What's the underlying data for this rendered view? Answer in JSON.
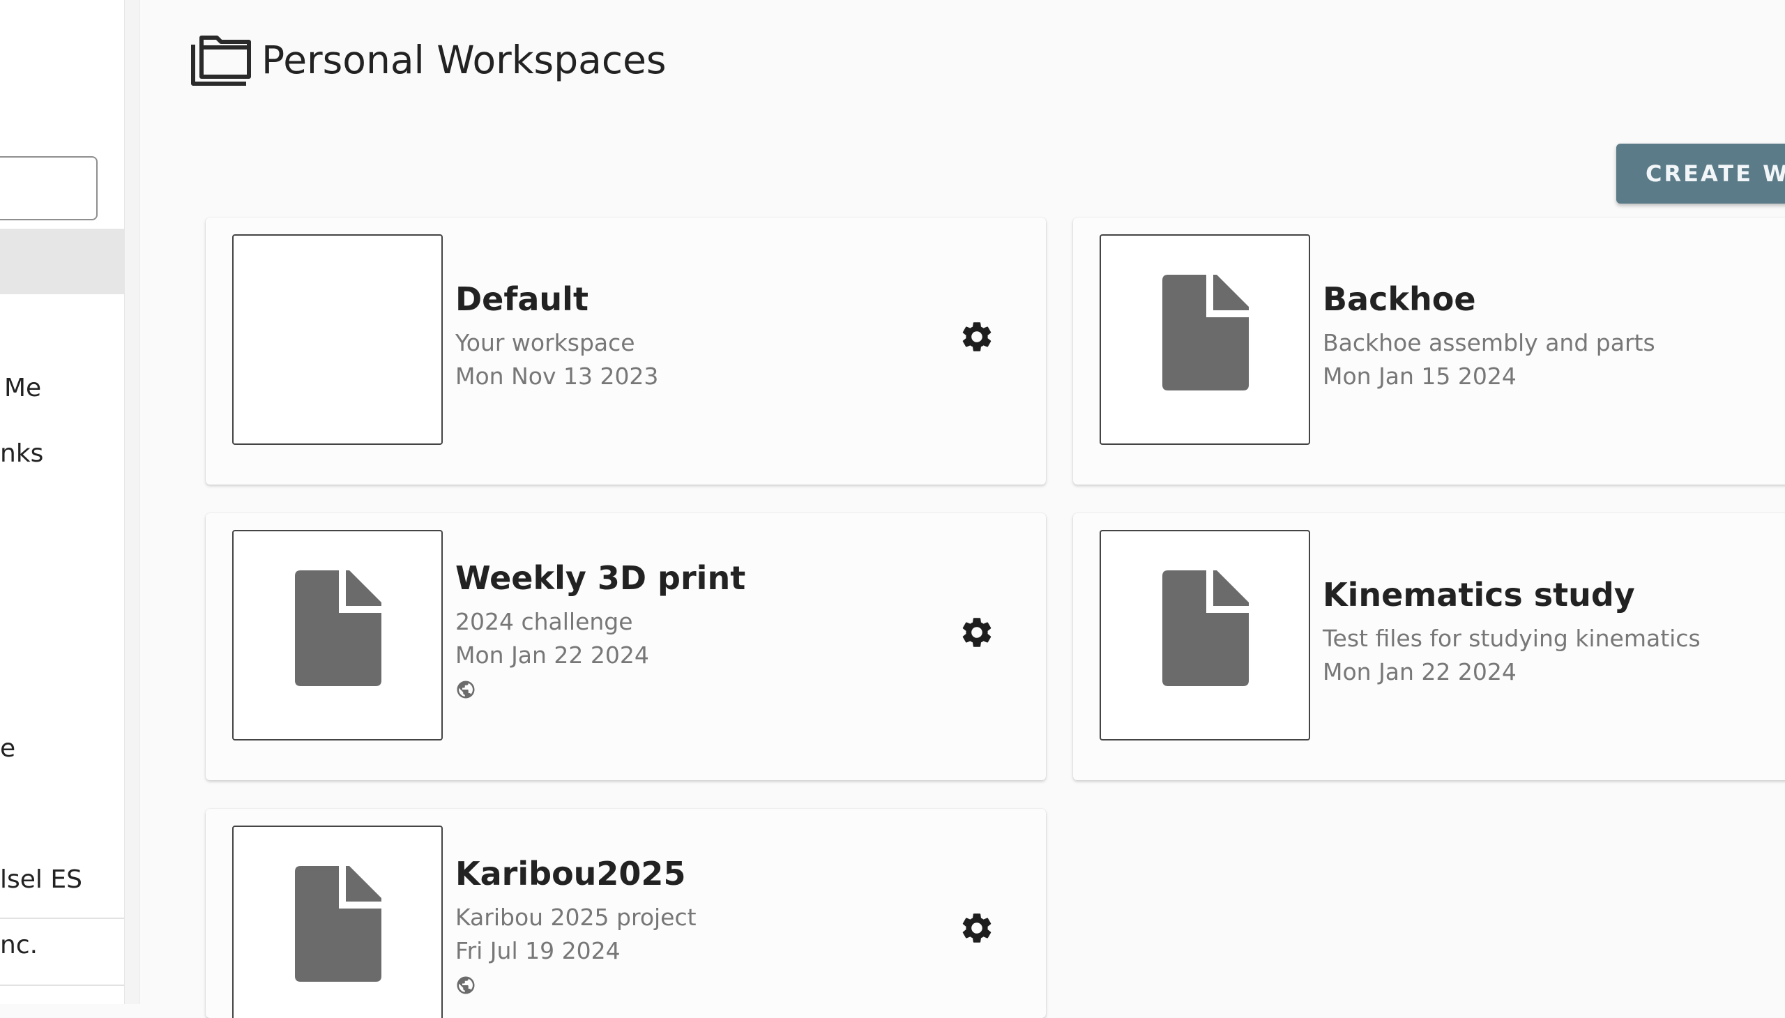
{
  "sidebar": {
    "items": [
      {
        "label": "Me"
      },
      {
        "label": "nks"
      },
      {
        "label": "e"
      },
      {
        "label": "lsel ES"
      },
      {
        "label": "nc."
      }
    ]
  },
  "header": {
    "title": "Personal Workspaces",
    "icon": "folder-icon"
  },
  "toolbar": {
    "create_label": "CREATE WO",
    "create_color": "#5b7b88"
  },
  "workspaces": [
    {
      "title": "Default",
      "description": "Your workspace",
      "date": "Mon Nov 13 2023",
      "thumbnail": "blank",
      "public": false,
      "settings": true
    },
    {
      "title": "Backhoe",
      "description": "Backhoe assembly and parts",
      "date": "Mon Jan 15 2024",
      "thumbnail": "document-icon",
      "public": false,
      "settings": false
    },
    {
      "title": "Weekly 3D print",
      "description": "2024 challenge",
      "date": "Mon Jan 22 2024",
      "thumbnail": "document-icon",
      "public": true,
      "settings": true
    },
    {
      "title": "Kinematics study",
      "description": "Test files for studying kinematics",
      "date": "Mon Jan 22 2024",
      "thumbnail": "document-icon",
      "public": false,
      "settings": false
    },
    {
      "title": "Karibou2025",
      "description": "Karibou 2025 project",
      "date": "Fri Jul 19 2024",
      "thumbnail": "document-icon",
      "public": true,
      "settings": true
    }
  ]
}
